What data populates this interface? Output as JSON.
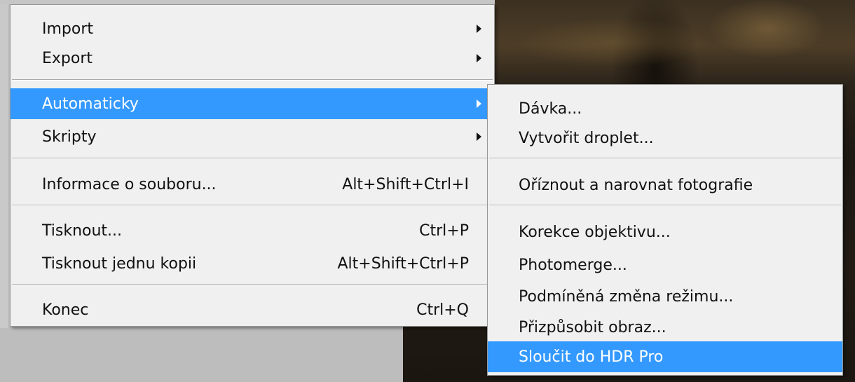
{
  "main_menu": {
    "items": [
      {
        "label": "Import",
        "shortcut": ""
      },
      {
        "label": "Export",
        "shortcut": ""
      },
      {
        "label": "Automaticky",
        "shortcut": ""
      },
      {
        "label": "Skripty",
        "shortcut": ""
      },
      {
        "label": "Informace o souboru...",
        "shortcut": "Alt+Shift+Ctrl+I"
      },
      {
        "label": "Tisknout...",
        "shortcut": "Ctrl+P"
      },
      {
        "label": "Tisknout jednu kopii",
        "shortcut": "Alt+Shift+Ctrl+P"
      },
      {
        "label": "Konec",
        "shortcut": "Ctrl+Q"
      }
    ],
    "highlighted": "Automaticky"
  },
  "sub_menu": {
    "items": [
      {
        "label": "Dávka..."
      },
      {
        "label": "Vytvořit droplet..."
      },
      {
        "label": "Oříznout a narovnat fotografie"
      },
      {
        "label": "Korekce objektivu..."
      },
      {
        "label": "Photomerge..."
      },
      {
        "label": "Podmíněná změna režimu..."
      },
      {
        "label": "Přizpůsobit obraz..."
      },
      {
        "label": "Sloučit do HDR Pro"
      }
    ],
    "highlighted": "Sloučit do HDR Pro"
  },
  "colors": {
    "highlight": "#3399ff",
    "menu_bg": "#f0f0f0"
  }
}
